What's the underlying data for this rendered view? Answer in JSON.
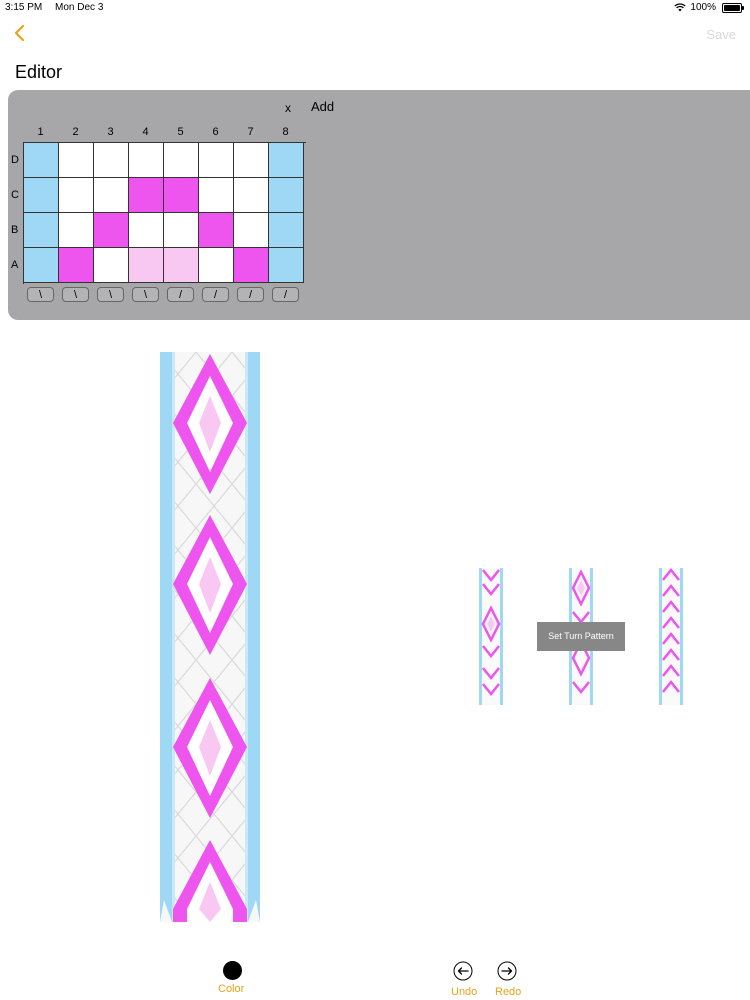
{
  "status_bar": {
    "time": "3:15 PM",
    "date": "Mon Dec 3",
    "battery": "100%"
  },
  "nav": {
    "save_label": "Save"
  },
  "title": "Editor",
  "editor": {
    "remove_label": "x",
    "add_label": "Add",
    "columns": [
      "1",
      "2",
      "3",
      "4",
      "5",
      "6",
      "7",
      "8"
    ],
    "rows": [
      "D",
      "C",
      "B",
      "A"
    ],
    "grid": [
      [
        "blue",
        "white",
        "white",
        "white",
        "white",
        "white",
        "white",
        "blue"
      ],
      [
        "blue",
        "white",
        "white",
        "magenta",
        "magenta",
        "white",
        "white",
        "blue"
      ],
      [
        "blue",
        "white",
        "magenta",
        "white",
        "white",
        "magenta",
        "white",
        "blue"
      ],
      [
        "blue",
        "magenta",
        "white",
        "pink",
        "pink",
        "white",
        "magenta",
        "blue"
      ]
    ],
    "directions": [
      "\\",
      "\\",
      "\\",
      "\\",
      "/",
      "/",
      "/",
      "/"
    ]
  },
  "colors": {
    "blue": "#9fd8f5",
    "white": "#ffffff",
    "magenta": "#ee55ee",
    "pink": "#f9c8f2",
    "accent": "#e8a317"
  },
  "tooltip": "Set Turn Pattern",
  "toolbar": {
    "color_label": "Color",
    "undo_label": "Undo",
    "redo_label": "Redo"
  }
}
